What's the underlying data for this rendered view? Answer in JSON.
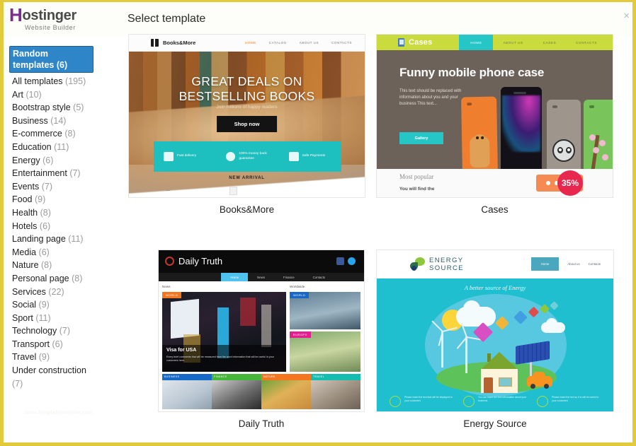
{
  "window": {
    "brand_main": "ostinger",
    "brand_initial": "H",
    "brand_sub": "Website Builder",
    "title": "Select template",
    "close_label": "×",
    "accent_border": "#e3c93c",
    "accent_selected": "#2e86c8",
    "watermark": "www.templatemonster.com"
  },
  "sidebar": {
    "items": [
      {
        "label": "Random templates",
        "count": "(6)",
        "active": true
      },
      {
        "label": "All templates",
        "count": "(195)",
        "active": false
      },
      {
        "label": "Art",
        "count": "(10)",
        "active": false
      },
      {
        "label": "Bootstrap style",
        "count": "(5)",
        "active": false
      },
      {
        "label": "Business",
        "count": "(14)",
        "active": false
      },
      {
        "label": "E-commerce",
        "count": "(8)",
        "active": false
      },
      {
        "label": "Education",
        "count": "(11)",
        "active": false
      },
      {
        "label": "Energy",
        "count": "(6)",
        "active": false
      },
      {
        "label": "Entertainment",
        "count": "(7)",
        "active": false
      },
      {
        "label": "Events",
        "count": "(7)",
        "active": false
      },
      {
        "label": "Food",
        "count": "(9)",
        "active": false
      },
      {
        "label": "Health",
        "count": "(8)",
        "active": false
      },
      {
        "label": "Hotels",
        "count": "(6)",
        "active": false
      },
      {
        "label": "Landing page",
        "count": "(11)",
        "active": false
      },
      {
        "label": "Media",
        "count": "(6)",
        "active": false
      },
      {
        "label": "Nature",
        "count": "(8)",
        "active": false
      },
      {
        "label": "Personal page",
        "count": "(8)",
        "active": false
      },
      {
        "label": "Services",
        "count": "(22)",
        "active": false
      },
      {
        "label": "Social",
        "count": "(9)",
        "active": false
      },
      {
        "label": "Sport",
        "count": "(11)",
        "active": false
      },
      {
        "label": "Technology",
        "count": "(7)",
        "active": false
      },
      {
        "label": "Transport",
        "count": "(6)",
        "active": false
      },
      {
        "label": "Travel",
        "count": "(9)",
        "active": false
      },
      {
        "label": "Under construction",
        "count": "(7)",
        "active": false
      }
    ]
  },
  "templates": [
    {
      "name": "Books&More",
      "nav": {
        "brand": "Books&More",
        "items": [
          "HOME",
          "CATALOG",
          "ABOUT US",
          "CONTACTS"
        ],
        "active": "HOME"
      },
      "hero": {
        "heading_line1": "GREAT DEALS ON",
        "heading_line2": "BESTSELLING BOOKS",
        "subheading": "Join millions of happy readers",
        "button": "Shop now"
      },
      "features": [
        "Fast delivery",
        "100% money back guarantee",
        "Safe Payments"
      ],
      "section_title": "NEW ARRIVAL"
    },
    {
      "name": "Cases",
      "nav": {
        "brand": "Cases",
        "items": [
          "HOME",
          "ABOUT US",
          "CASES",
          "CONTACTS"
        ],
        "active": "HOME"
      },
      "hero": {
        "heading": "Funny mobile phone case",
        "paragraph": "This text should be replaced with information about you and your business This text...",
        "button": "Gallery"
      },
      "bottom": {
        "title": "Most popular",
        "subtitle": "You will find the",
        "badge": "35%"
      }
    },
    {
      "name": "Daily Truth",
      "nav": {
        "brand": "Daily Truth",
        "items": [
          "Home",
          "News",
          "Finance",
          "Contacts"
        ],
        "active": "Home"
      },
      "columns": {
        "left": "News",
        "right": "Worldwide"
      },
      "feature": {
        "category": "WORLD",
        "headline": "Visa for USA",
        "excerpt": "Every brief comments that will be measured from the word information that will be useful in your customers here."
      },
      "side_categories": [
        "WORLD",
        "EUROPE"
      ],
      "tiles": [
        "BUSINESS",
        "FINANCE",
        "NATURE",
        "TRAVEL"
      ]
    },
    {
      "name": "Energy Source",
      "nav": {
        "brand_line1": "ENERGY",
        "brand_line2": "SOURCE",
        "items": [
          "Home",
          "About us",
          "Contacts"
        ],
        "active": "Home"
      },
      "hero": {
        "heading": "A better source of Energy"
      },
      "features": [
        "Please insert the text that will be displayed to your customers",
        "You can insert the text information about your business",
        "Please insert the text so it is will be useful to your customers"
      ]
    }
  ]
}
